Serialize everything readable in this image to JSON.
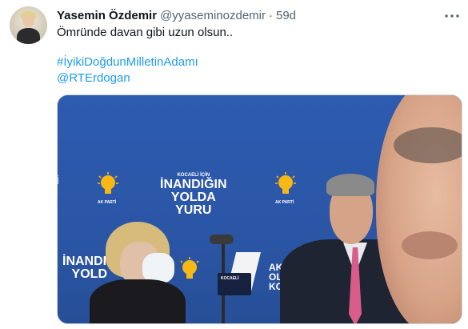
{
  "tweet": {
    "author_name": "Yasemin Özdemir",
    "author_handle": "@yyaseminozdemir",
    "separator": "·",
    "time": "59d",
    "text": "Ömründe davan gibi uzun olsun..",
    "hashtag": "#İyikiDoğdunMilletinAdamı",
    "mention": "@RTErdogan",
    "more_icon": "more-horizontal-icon",
    "avatar_icon": "profile-avatar"
  },
  "media": {
    "slogans": [
      {
        "top": "KOCAELİ İÇİN",
        "main1": "İNANDIĞIN",
        "main2": "YOLDA",
        "main3": "YURU"
      },
      {
        "top": "",
        "main1": "İNANDIĞ",
        "main2": "YOLD",
        "main3": ""
      },
      {
        "top": "",
        "main1": "AK PA",
        "main2": "OLAC",
        "main3": "KONA"
      }
    ],
    "party_label": "AK PARTİ",
    "lectern_text": "KOCAELİ"
  },
  "colors": {
    "link": "#1d9bf0",
    "muted": "#536471",
    "stage_blue": "#2b56a6"
  }
}
